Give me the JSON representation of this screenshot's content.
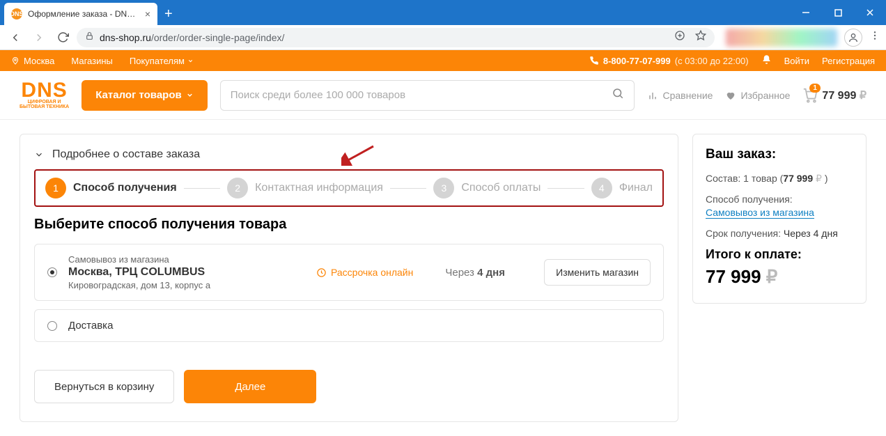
{
  "browser": {
    "tab_title": "Оформление заказа - DNS – ин",
    "url_domain": "dns-shop.ru",
    "url_path": "/order/order-single-page/index/"
  },
  "topbar": {
    "city": "Москва",
    "stores": "Магазины",
    "customers": "Покупателям",
    "phone": "8-800-77-07-999",
    "hours": "(с 03:00 до 22:00)",
    "login": "Войти",
    "register": "Регистрация"
  },
  "header": {
    "logo_sub1": "ЦИФРОВАЯ И",
    "logo_sub2": "БЫТОВАЯ ТЕХНИКА",
    "catalog": "Каталог товаров",
    "search_placeholder": "Поиск среди более 100 000 товаров",
    "compare": "Сравнение",
    "favorites": "Избранное",
    "cart_badge": "1",
    "cart_total": "77 999"
  },
  "checkout": {
    "details_toggle": "Подробнее о составе заказа",
    "steps": {
      "s1": "Способ получения",
      "s2": "Контактная информация",
      "s3": "Способ оплаты",
      "s4": "Финал"
    },
    "section_title": "Выберите способ получения товара",
    "pickup": {
      "type": "Самовывоз из магазина",
      "store": "Москва, ТРЦ COLUMBUS",
      "addr": "Кировоградская, дом 13, корпус а",
      "installment": "Рассрочка онлайн",
      "eta_prefix": "Через ",
      "eta_value": "4 дня",
      "change": "Изменить магазин"
    },
    "delivery_label": "Доставка",
    "back_btn": "Вернуться в корзину",
    "next_btn": "Далее"
  },
  "sidebar": {
    "title": "Ваш заказ:",
    "composition_label": "Состав: ",
    "composition_value": "1 товар",
    "composition_price": "77 999",
    "method_label": "Способ получения:",
    "method_link": "Самовывоз из магазина",
    "eta_label": "Срок получения: ",
    "eta_value": "Через 4 дня",
    "total_label": "Итого к оплате:",
    "total_value": "77 999"
  }
}
